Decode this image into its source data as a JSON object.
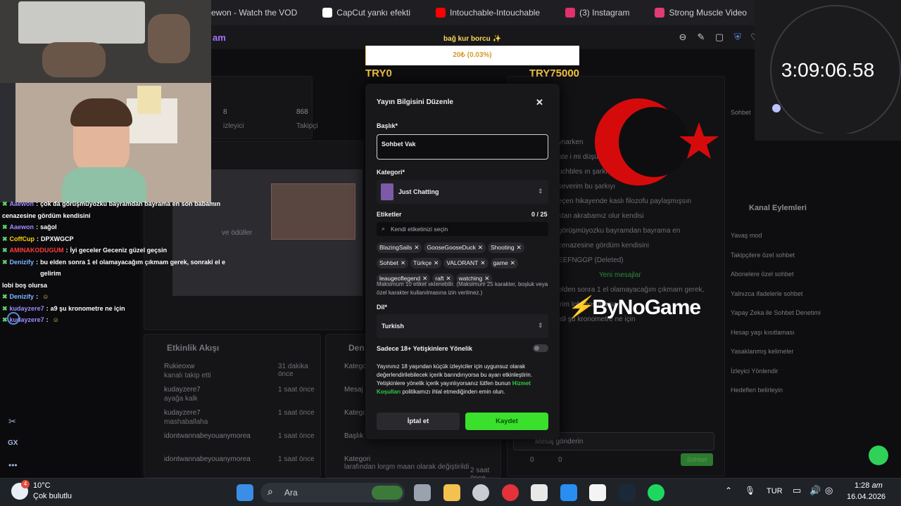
{
  "browser": {
    "tabs": [
      {
        "label": "ewon - Watch the VOD",
        "icon": "twitch-favicon-icon",
        "color": "#9146ff"
      },
      {
        "label": "CapCut yankı efekti",
        "icon": "capcut-favicon-icon",
        "color": "#ffffff"
      },
      {
        "label": "Intouchable-Intouchable",
        "icon": "youtube-favicon-icon",
        "color": "#ff0000"
      },
      {
        "label": "(3) Instagram",
        "icon": "instagram-favicon-icon",
        "color": "#e1306c"
      },
      {
        "label": "Strong Muscle Video",
        "icon": "twitch-favicon-icon",
        "color": "#e03b73"
      }
    ],
    "page_title": "am"
  },
  "dashboard": {
    "stats_title": "tikleri",
    "stat1_value": "8",
    "stat1_label": "izleyici",
    "stat2_value": "868",
    "stat2_label": "Takipçi",
    "preview_title": "emesi",
    "rewards_label": "ve ödüller",
    "activity_title": "Etkinlik Akışı",
    "activity_items": [
      {
        "name": "Rukieoxw",
        "sub": "kanalı takip etti",
        "time": "31 dakika önce"
      },
      {
        "name": "kudayzere7",
        "sub": "ayağa kalk",
        "time": "1 saat önce"
      },
      {
        "name": "kudayzere7",
        "sub": "mashaballaha",
        "time": "1 saat önce"
      },
      {
        "name": "idontwannabeyouanymorea",
        "sub": "",
        "time": "1 saat önce"
      },
      {
        "name": "idontwannabeyouanymorea",
        "sub": "",
        "time": "1 saat önce"
      }
    ],
    "middle_title": "Den",
    "middle_items": [
      "Katego",
      "Mesaj",
      "Katego",
      "Başlık",
      "Kategori"
    ],
    "middle_sub": "CoffCup",
    "middle_note": "larafından lorgm maan olarak değiştirildi",
    "middle_time": "2 saat önce",
    "chat_lines": [
      "ynarken",
      "ate i mi düşü",
      "uchbles ın şarkı",
      "severim bu şarkıyı",
      "eçen hikayende kaslı filozofu paylaşmışsın",
      "ktan akrabamız olur kendisi",
      "görüşmüyozku bayramdan bayrama en",
      "cenazesine gördüm kendisini",
      "EEFNGGP (Deleted)",
      "Yeni mesajlar",
      "elden sonra 1 el olamayacağım çıkmam gerek,",
      "irim lobi boş olursa",
      "a9 şu kronometre ne için"
    ],
    "chat_user_top": "nerhum",
    "chat_placeholder": "Mesaj gönderin",
    "chat_button": "Sohbet",
    "chat_counts": [
      "0",
      "0"
    ]
  },
  "right_panel": {
    "title": "Kanal Eylemleri",
    "header_tab": "Sohbet",
    "items": [
      "Yavaş mod",
      "Takipçilere özel sohbet",
      "Abonelere özel sohbet",
      "Yalnızca ifadelerle sohbet",
      "Yapay Zeka ile Sohbet Denetimi",
      "Hesap yaşı kısıtlaması",
      "Yasaklanmış kelimeler",
      "İzleyici Yönlendir",
      "Hedefleri belirleyin"
    ],
    "sub": "1 dk."
  },
  "overlay": {
    "chat": [
      {
        "user": "Aaewon",
        "color": "#9f8cff",
        "text": "çok da görüşmüyozku bayramdan bayrama en son babamın"
      },
      {
        "user": "",
        "color": "#ffffff",
        "text": "cenazesine gördüm kendisini"
      },
      {
        "user": "Aaewon",
        "color": "#9f8cff",
        "text": "sağol"
      },
      {
        "user": "CoffCup",
        "color": "#ffd400",
        "text": "DPXWGCP"
      },
      {
        "user": "AMINAKODUGUM",
        "color": "#ff3b3b",
        "text": "İyi geceler Geceniz güzel geçsin"
      },
      {
        "user": "Denizify",
        "color": "#7ab8ff",
        "text": "bu elden sonra 1 el olamayacağım çıkmam gerek, sonraki el e gelirim"
      },
      {
        "user": "",
        "color": "#ffffff",
        "text": "lobi boş olursa"
      },
      {
        "user": "Denizify",
        "color": "#7ab8ff",
        "text": ""
      },
      {
        "user": "kudayzere7",
        "color": "#9f8cff",
        "text": "a9 şu kronometre ne için"
      },
      {
        "user": "kudayzere7",
        "color": "#9f8cff",
        "text": ""
      }
    ],
    "donation_title": "bağ kur borcu ✨",
    "donation_value": "20₺ (0.03%)",
    "donation_progress": 0.0003,
    "donation_min": "TRY0",
    "donation_max": "TRY75000",
    "stopwatch": "3:09:06.58",
    "brand": "ByNoGame"
  },
  "modal": {
    "title": "Yayın Bilgisini Düzenle",
    "title_label": "Başlık*",
    "title_value": "Sohbet Vak",
    "category_label": "Kategori*",
    "category_value": "Just Chatting",
    "tags_label": "Etiketler",
    "tags_count": "0 / 25",
    "tags_placeholder": "Kendi etiketinizi seçin",
    "tags": [
      "BlazingSails",
      "GooseGooseDuck",
      "Shooting",
      "Sohbet",
      "Türkçe",
      "VALORANT",
      "game",
      "leaugeoflegend",
      "raft",
      "watching"
    ],
    "tags_hint": "Maksimum 10 etiket eklenebilir. (Maksimum 25 karakter, boşluk veya özel karakter kullanılmasına izin verilmez.)",
    "lang_label": "Dil*",
    "lang_value": "Turkish",
    "adult_label": "Sadece 18+ Yetişkinlere Yönelik",
    "notice": "Yayınınız 18 yaşından küçük izleyiciler için uygunsuz olarak değerlendirilebilecek içerik barındırıyorsa bu ayarı etkinleştirin. Yetişkinlere yönelik içerik yayınlıyorsanız lütfen bunun",
    "notice_link": "Hizmet Koşulları",
    "notice_end": "politikamızı ihlal etmediğinden emin olun.",
    "cancel": "İptal et",
    "save": "Kaydet"
  },
  "taskbar": {
    "weather_temp": "10°C",
    "weather_desc": "Çok bulutlu",
    "weather_badge": "4",
    "search": "Ara",
    "lang": "TUR",
    "time": "1:28",
    "ampm": "am",
    "date": "16.04.2026"
  },
  "left_strip": {
    "gx": "GX"
  }
}
